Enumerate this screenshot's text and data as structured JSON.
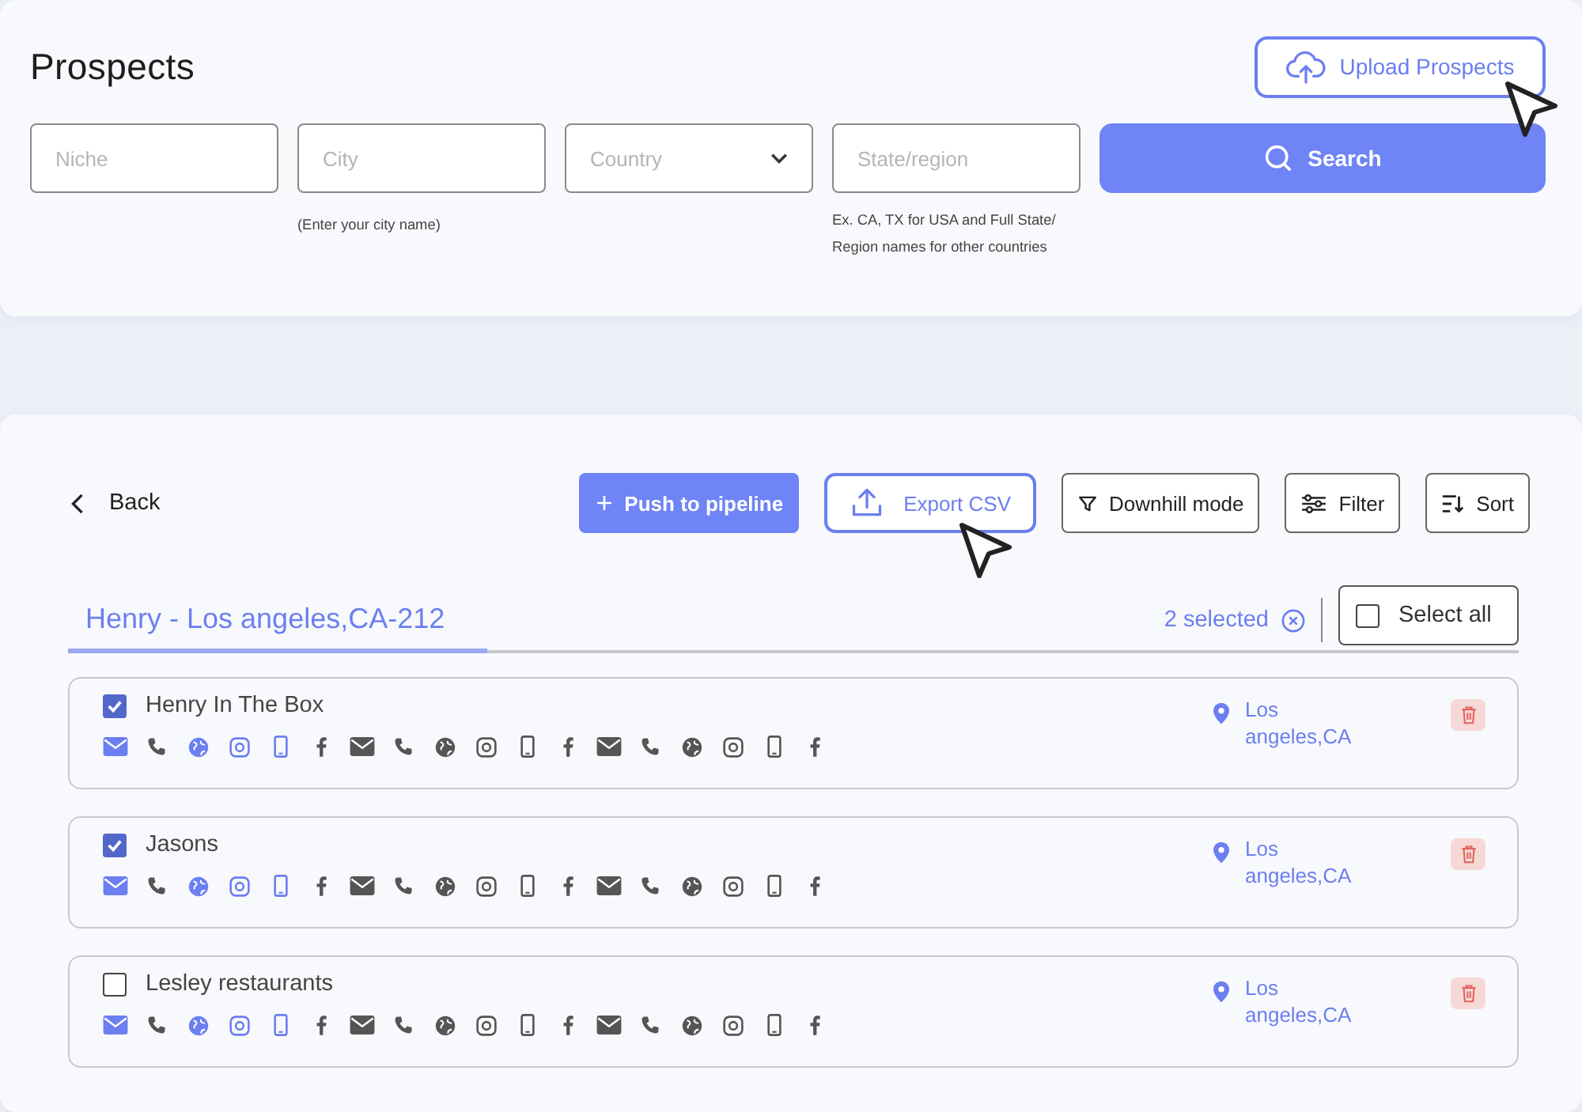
{
  "search_panel": {
    "title": "Prospects",
    "upload_button": "Upload Prospects",
    "fields": [
      {
        "kind": "text",
        "placeholder": "Niche"
      },
      {
        "kind": "text",
        "placeholder": "City",
        "hint": "(Enter your city name)"
      },
      {
        "kind": "select",
        "placeholder": "Country"
      },
      {
        "kind": "text",
        "placeholder": "State/region",
        "hint": "Ex. CA, TX for USA and Full State/ Region names for other countries"
      }
    ],
    "search_button": "Search"
  },
  "results": {
    "back": "Back",
    "toolbar": [
      {
        "kind": "primary",
        "label": "Push to pipeline"
      },
      {
        "kind": "outline-accent",
        "label": "Export CSV"
      },
      {
        "kind": "outline",
        "label": "Downhill mode"
      },
      {
        "kind": "outline",
        "label": "Filter"
      },
      {
        "kind": "outline",
        "label": "Sort"
      }
    ],
    "tab": {
      "label": "Henry - Los angeles,CA-212",
      "selected": true
    },
    "selected_count": "2 selected",
    "select_all": {
      "label": "Select all",
      "checked": false
    },
    "rows": [
      {
        "name": "Henry In The Box",
        "checked": true,
        "location": "Los angeles,CA",
        "contacts": [
          {
            "kind": "mail",
            "active": true
          },
          {
            "kind": "phone",
            "active": false
          },
          {
            "kind": "globe",
            "active": true
          },
          {
            "kind": "instagram",
            "active": true
          },
          {
            "kind": "mobile",
            "active": true
          },
          {
            "kind": "facebook",
            "active": false
          },
          {
            "kind": "mail",
            "active": false
          },
          {
            "kind": "phone",
            "active": false
          },
          {
            "kind": "globe",
            "active": false
          },
          {
            "kind": "instagram",
            "active": false
          },
          {
            "kind": "mobile",
            "active": false
          },
          {
            "kind": "facebook",
            "active": false
          },
          {
            "kind": "mail",
            "active": false
          },
          {
            "kind": "phone",
            "active": false
          },
          {
            "kind": "globe",
            "active": false
          },
          {
            "kind": "instagram",
            "active": false
          },
          {
            "kind": "mobile",
            "active": false
          },
          {
            "kind": "facebook",
            "active": false
          }
        ]
      },
      {
        "name": "Jasons",
        "checked": true,
        "location": "Los angeles,CA",
        "contacts": [
          {
            "kind": "mail",
            "active": true
          },
          {
            "kind": "phone",
            "active": false
          },
          {
            "kind": "globe",
            "active": true
          },
          {
            "kind": "instagram",
            "active": true
          },
          {
            "kind": "mobile",
            "active": true
          },
          {
            "kind": "facebook",
            "active": false
          },
          {
            "kind": "mail",
            "active": false
          },
          {
            "kind": "phone",
            "active": false
          },
          {
            "kind": "globe",
            "active": false
          },
          {
            "kind": "instagram",
            "active": false
          },
          {
            "kind": "mobile",
            "active": false
          },
          {
            "kind": "facebook",
            "active": false
          },
          {
            "kind": "mail",
            "active": false
          },
          {
            "kind": "phone",
            "active": false
          },
          {
            "kind": "globe",
            "active": false
          },
          {
            "kind": "instagram",
            "active": false
          },
          {
            "kind": "mobile",
            "active": false
          },
          {
            "kind": "facebook",
            "active": false
          }
        ]
      },
      {
        "name": "Lesley restaurants",
        "checked": false,
        "location": "Los angeles,CA",
        "contacts": [
          {
            "kind": "mail",
            "active": true
          },
          {
            "kind": "phone",
            "active": false
          },
          {
            "kind": "globe",
            "active": true
          },
          {
            "kind": "instagram",
            "active": true
          },
          {
            "kind": "mobile",
            "active": true
          },
          {
            "kind": "facebook",
            "active": false
          },
          {
            "kind": "mail",
            "active": false
          },
          {
            "kind": "phone",
            "active": false
          },
          {
            "kind": "globe",
            "active": false
          },
          {
            "kind": "instagram",
            "active": false
          },
          {
            "kind": "mobile",
            "active": false
          },
          {
            "kind": "facebook",
            "active": false
          },
          {
            "kind": "mail",
            "active": false
          },
          {
            "kind": "phone",
            "active": false
          },
          {
            "kind": "globe",
            "active": false
          },
          {
            "kind": "instagram",
            "active": false
          },
          {
            "kind": "mobile",
            "active": false
          },
          {
            "kind": "facebook",
            "active": false
          }
        ]
      }
    ]
  }
}
